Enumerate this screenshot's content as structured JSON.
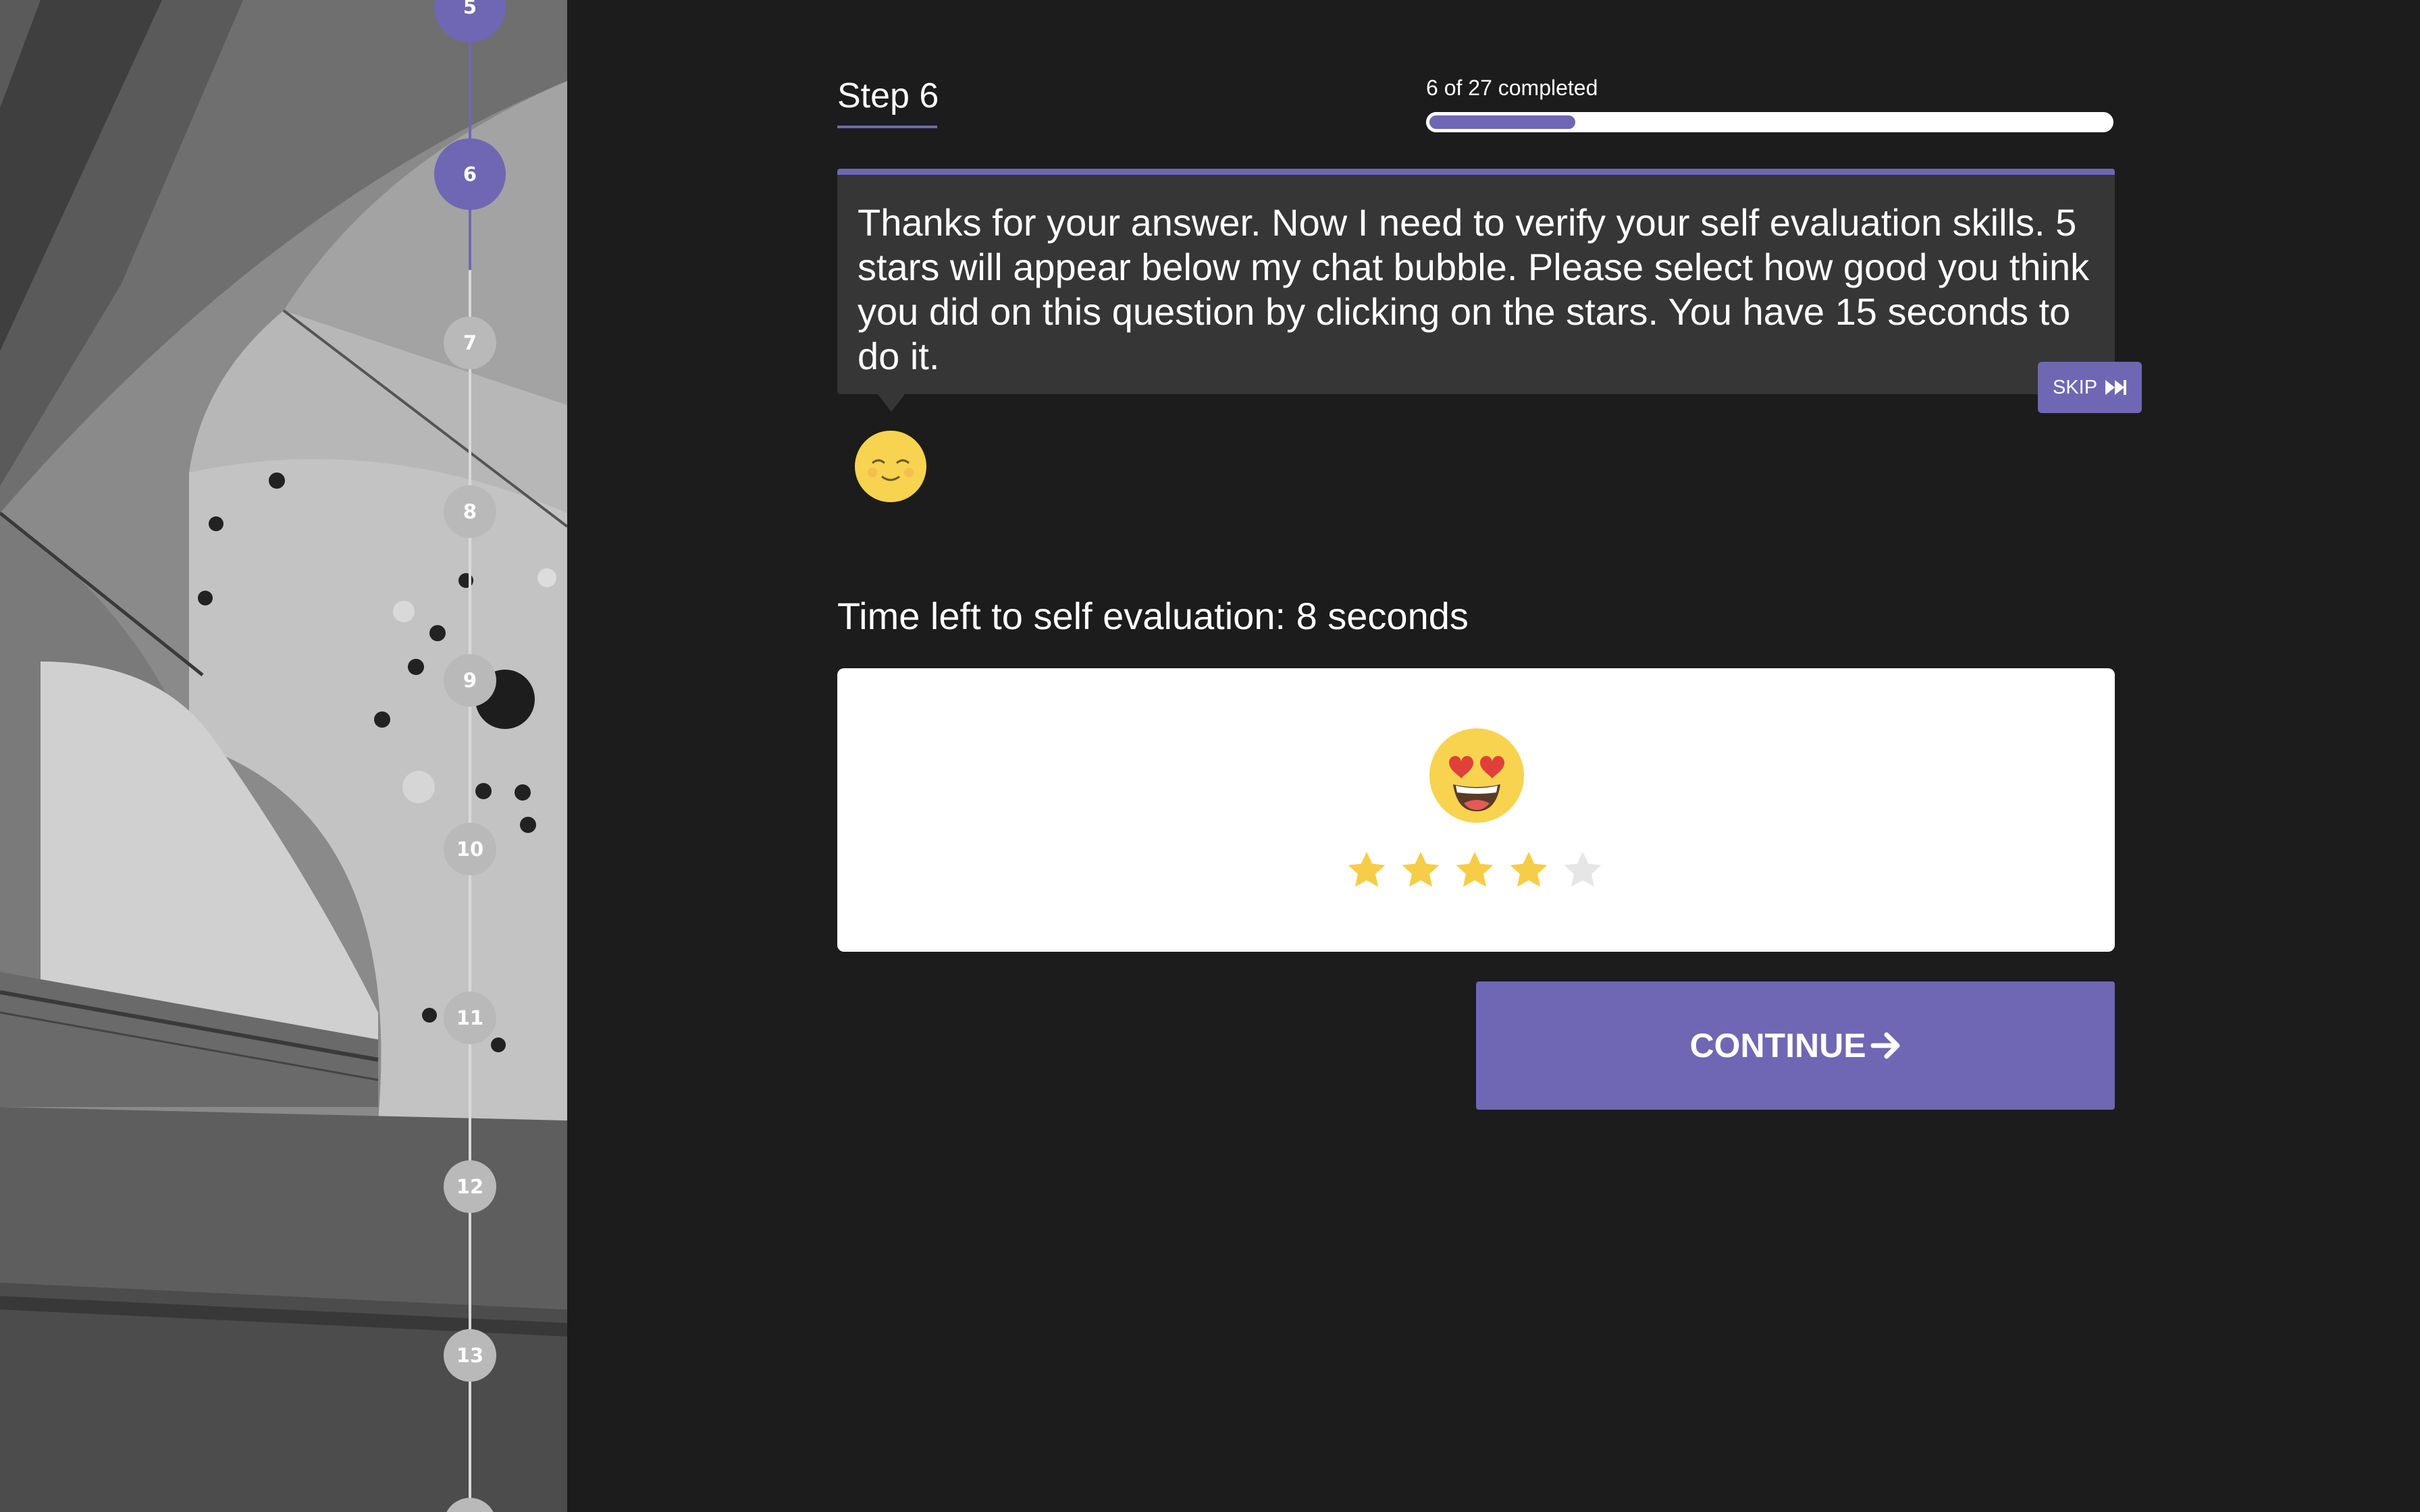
{
  "timeline": {
    "steps": [
      "5",
      "6",
      "7",
      "8",
      "9",
      "10",
      "11",
      "12",
      "13"
    ],
    "current_step": "6",
    "accent_color": "#6f67b3",
    "inactive_color": "#b9b9b9"
  },
  "header": {
    "step_title": "Step 6",
    "progress_label": "6 of 27 completed",
    "progress_fraction": 0.2222
  },
  "chat": {
    "message": "Thanks for your answer. Now I need to verify your self evaluation skills. 5 stars will appear below my chat bubble. Please select how good you think you did on this question by clicking on the stars. You have 15 seconds to do it.",
    "skip_label": "SKIP",
    "skip_icon": "fast-forward-icon",
    "avatar_icon": "smiling-face-emoji"
  },
  "evaluation": {
    "timer_text": "Time left to self evaluation: 8 seconds",
    "rating_emoji": "heart-eyes-emoji",
    "rating_value": 4,
    "rating_max": 5,
    "star_active_color": "#f6cd47",
    "star_inactive_color": "#e6e6e6"
  },
  "actions": {
    "continue_label": "CONTINUE",
    "continue_icon": "arrow-right-icon"
  }
}
